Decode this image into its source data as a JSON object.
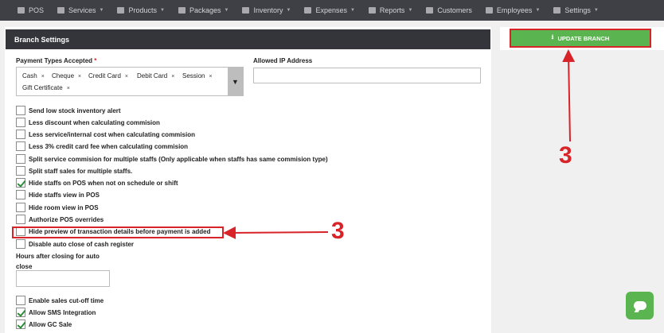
{
  "nav": {
    "items": [
      {
        "label": "POS",
        "icon": "monitor-icon",
        "caret": false
      },
      {
        "label": "Services",
        "icon": "hand-icon",
        "caret": true
      },
      {
        "label": "Products",
        "icon": "cart-icon",
        "caret": true
      },
      {
        "label": "Packages",
        "icon": "tags-icon",
        "caret": true
      },
      {
        "label": "Inventory",
        "icon": "boxes-icon",
        "caret": true
      },
      {
        "label": "Expenses",
        "icon": "edit-icon",
        "caret": true
      },
      {
        "label": "Reports",
        "icon": "bar-chart-icon",
        "caret": true
      },
      {
        "label": "Customers",
        "icon": "users-icon",
        "caret": false
      },
      {
        "label": "Employees",
        "icon": "user-icon",
        "caret": true
      },
      {
        "label": "Settings",
        "icon": "gear-icon",
        "caret": true
      }
    ]
  },
  "panel": {
    "title": "Branch Settings"
  },
  "payment": {
    "label": "Payment Types Accepted",
    "required_mark": "*",
    "tags": [
      "Cash",
      "Cheque",
      "Credit Card",
      "Debit Card",
      "Session",
      "Gift Certificate"
    ],
    "remove_glyph": "×",
    "dropdown_glyph": "▼"
  },
  "ip": {
    "label": "Allowed IP Address",
    "value": ""
  },
  "options": [
    {
      "label": "Send low stock inventory alert",
      "checked": false
    },
    {
      "label": "Less discount when calculating commision",
      "checked": false
    },
    {
      "label": "Less service/internal cost when calculating commision",
      "checked": false
    },
    {
      "label": "Less 3% credit card fee when calculating commision",
      "checked": false
    },
    {
      "label": "Split service commision for multiple staffs (Only applicable when staffs has same commision type)",
      "checked": false
    },
    {
      "label": "Split staff sales for multiple staffs.",
      "checked": false
    },
    {
      "label": "Hide staffs on POS when not on schedule or shift",
      "checked": true
    },
    {
      "label": "Hide staffs view in POS",
      "checked": false
    },
    {
      "label": "Hide room view in POS",
      "checked": false
    },
    {
      "label": "Authorize POS overrides",
      "checked": false
    },
    {
      "label": "Hide preview of transaction details before payment is added",
      "checked": false
    },
    {
      "label": "Disable auto close of cash register",
      "checked": false
    }
  ],
  "hours": {
    "label": "Hours after closing for auto close",
    "value": ""
  },
  "options2": [
    {
      "label": "Enable sales cut-off time",
      "checked": false
    },
    {
      "label": "Allow SMS Integration",
      "checked": true
    },
    {
      "label": "Allow GC Sale",
      "checked": true
    }
  ],
  "update_button": {
    "label": "UPDATE BRANCH",
    "icon": "download-icon"
  },
  "annotations": {
    "step_top": "3",
    "step_middle": "3",
    "color": "#d82329"
  },
  "colors": {
    "nav_bg": "#3f4045",
    "header_bg": "#33353b",
    "accent_green": "#5ab44f"
  }
}
